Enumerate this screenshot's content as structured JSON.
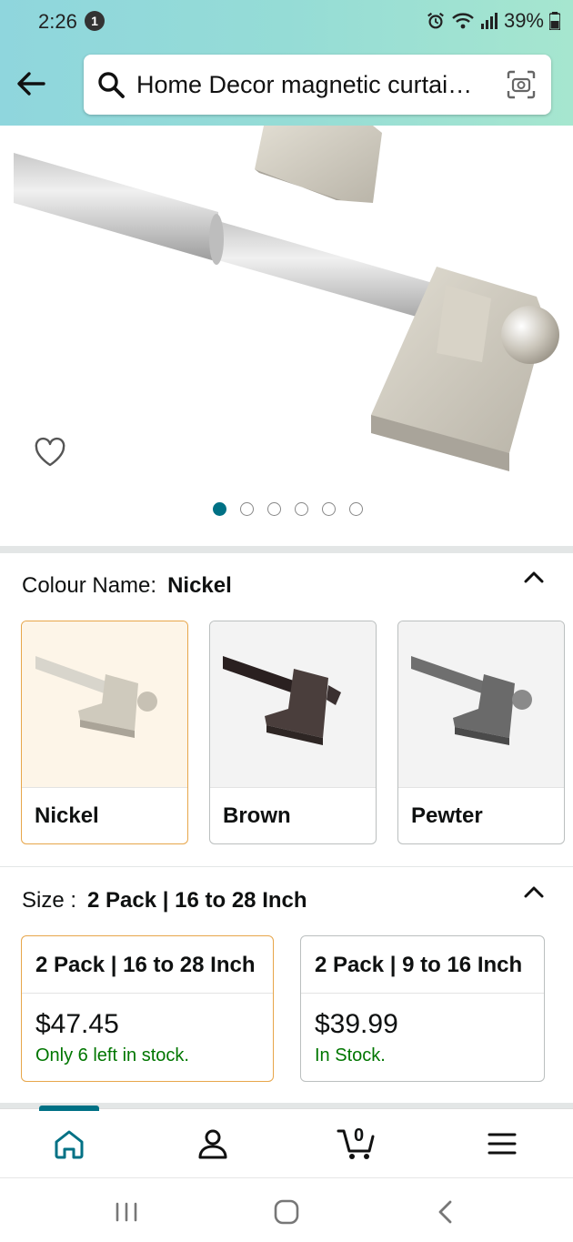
{
  "status_bar": {
    "time": "2:26",
    "notification_count": "1",
    "battery": "39%"
  },
  "search": {
    "query": "Home Decor magnetic curtai…"
  },
  "gallery": {
    "image_count": 6,
    "active_index": 0
  },
  "colour": {
    "label": "Colour Name:",
    "selected": "Nickel",
    "options": [
      {
        "name": "Nickel",
        "selected": true
      },
      {
        "name": "Brown",
        "selected": false
      },
      {
        "name": "Pewter",
        "selected": false
      }
    ]
  },
  "size": {
    "label": "Size :",
    "selected": "2 Pack | 16 to 28 Inch",
    "options": [
      {
        "title": "2 Pack | 16 to 28 Inch",
        "price": "$47.45",
        "stock": "Only 6 left in stock.",
        "selected": true
      },
      {
        "title": "2 Pack | 9 to 16 Inch",
        "price": "$39.99",
        "stock": "In Stock.",
        "selected": false
      }
    ]
  },
  "nav": {
    "items": [
      "home-icon",
      "account-icon",
      "cart-icon",
      "menu-icon"
    ],
    "cart_count": "0"
  },
  "colors": {
    "accent": "#007185",
    "selected_border": "#e7a64a",
    "in_stock_green": "#007600"
  }
}
